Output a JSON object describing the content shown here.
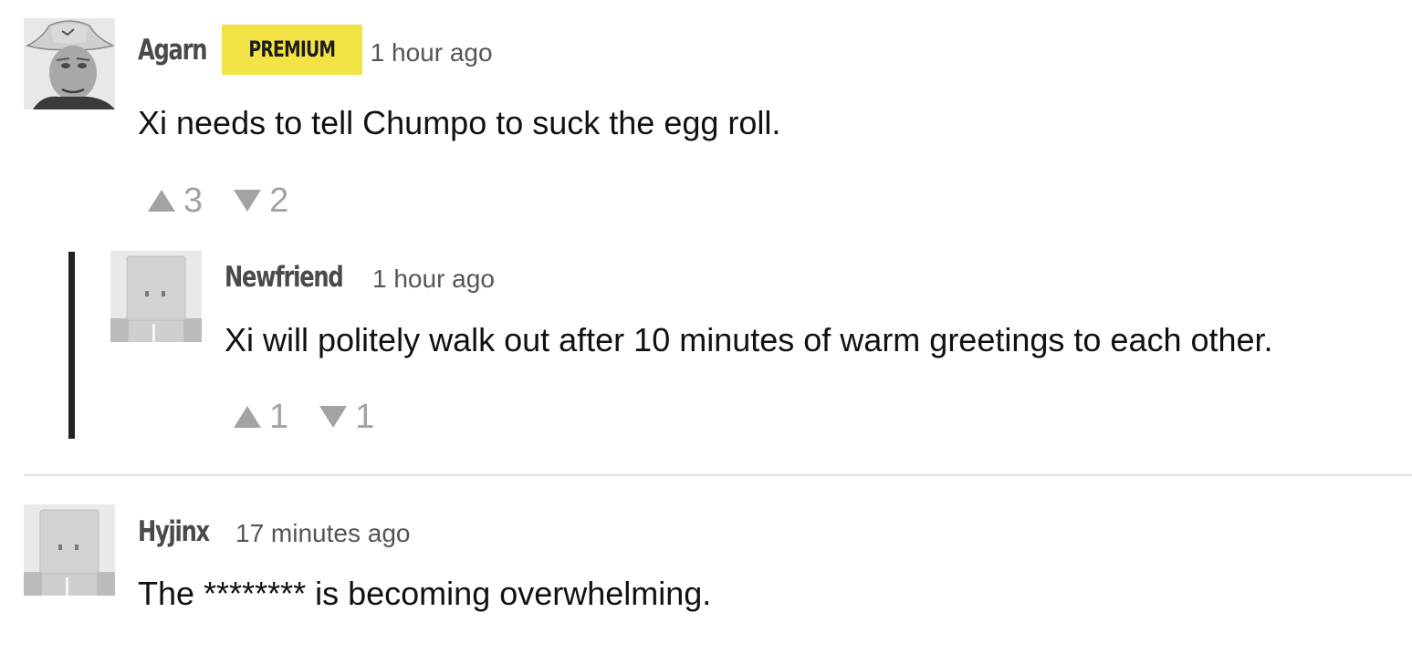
{
  "comments": [
    {
      "username": "Agarn",
      "badge": "PREMIUM",
      "timestamp": "1 hour ago",
      "body": "Xi needs to tell Chumpo to suck the egg roll.",
      "upvotes": "3",
      "downvotes": "2",
      "avatar": "cowboy-hat-man-photo",
      "replies": [
        {
          "username": "Newfriend",
          "timestamp": "1 hour ago",
          "body": "Xi will politely walk out after 10 minutes of warm greetings to each other.",
          "upvotes": "1",
          "downvotes": "1",
          "avatar": "paper-bag-default-avatar"
        }
      ]
    },
    {
      "username": "Hyjinx",
      "timestamp": "17 minutes ago",
      "body": "The ******** is becoming overwhelming.",
      "avatar": "paper-bag-default-avatar"
    }
  ],
  "icons": {
    "upvote": "triangle-up-icon",
    "downvote": "triangle-down-icon"
  },
  "colors": {
    "badge_background": "#f4e344",
    "vote_grey": "#a3a3a3",
    "reply_rail": "#222222",
    "username": "#4a4a4a"
  }
}
